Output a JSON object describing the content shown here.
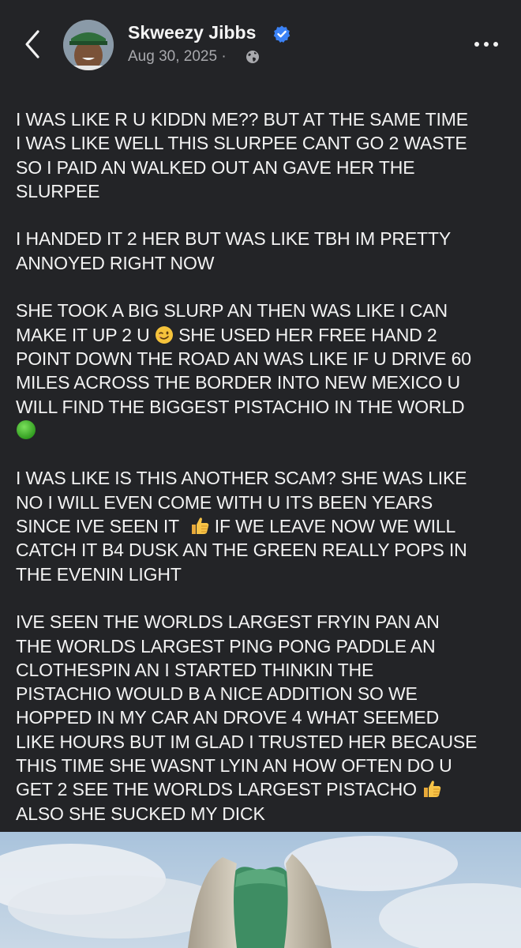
{
  "header": {
    "back_icon": "chevron-left-icon",
    "author_name": "Skweezy Jibbs",
    "verified_icon": "verified-badge-icon",
    "date": "Aug 30, 2025 ·",
    "audience_icon": "globe-icon",
    "more_icon": "more-horizontal-icon",
    "accent_color": "#3b82f6"
  },
  "post": {
    "paragraphs": [
      {
        "lines": [
          "I WAS LIKE R U KIDDN ME?? BUT AT THE SAME TIME",
          "I WAS LIKE WELL THIS SLURPEE CANT GO 2 WASTE",
          "SO I PAID AN WALKED OUT AN GAVE HER THE",
          "SLURPEE"
        ]
      },
      {
        "lines": [
          "I HANDED IT 2 HER BUT WAS LIKE TBH IM PRETTY",
          "ANNOYED RIGHT NOW"
        ]
      },
      {
        "line1_a": "SHE TOOK A BIG SLURP AN THEN WAS LIKE I CAN",
        "line2_a": "MAKE IT UP 2 U",
        "line2_emoji": "winking-face-emoji",
        "line2_b": "SHE USED HER FREE HAND 2",
        "line3": "POINT DOWN THE ROAD AN WAS LIKE IF U DRIVE 60",
        "line4": "MILES ACROSS THE BORDER INTO NEW MEXICO U",
        "line5": "WILL FIND THE BIGGEST PISTACHIO IN THE WORLD",
        "line6_emoji": "green-circle-emoji"
      },
      {
        "line1": "I WAS LIKE IS THIS ANOTHER SCAM? SHE WAS LIKE",
        "line2": "NO I WILL EVEN COME WITH U ITS BEEN YEARS",
        "line3_a": "SINCE IVE SEEN IT",
        "line3_emoji": "thumbs-up-emoji",
        "line3_b": "IF WE LEAVE NOW WE WILL",
        "line4": "CATCH IT B4 DUSK AN THE GREEN REALLY POPS IN",
        "line5": "THE EVENIN LIGHT"
      },
      {
        "line1": "IVE SEEN THE WORLDS LARGEST FRYIN PAN AN",
        "line2": "THE WORLDS LARGEST PING PONG PADDLE AN",
        "line3": "CLOTHESPIN AN I STARTED THINKIN THE",
        "line4": "PISTACHIO WOULD B A NICE ADDITION SO WE",
        "line5": "HOPPED IN MY CAR AN DROVE 4 WHAT SEEMED",
        "line6": "LIKE HOURS BUT IM GLAD I TRUSTED HER BECAUSE",
        "line7": "THIS TIME SHE WASNT LYIN AN HOW OFTEN DO U",
        "line8_a": "GET 2 SEE THE WORLDS LARGEST PISTACHO",
        "line8_emoji": "thumbs-up-emoji",
        "line9": "ALSO SHE SUCKED MY DICK"
      }
    ]
  },
  "photo": {
    "subject": "giant-pistachio-statue-photo"
  }
}
